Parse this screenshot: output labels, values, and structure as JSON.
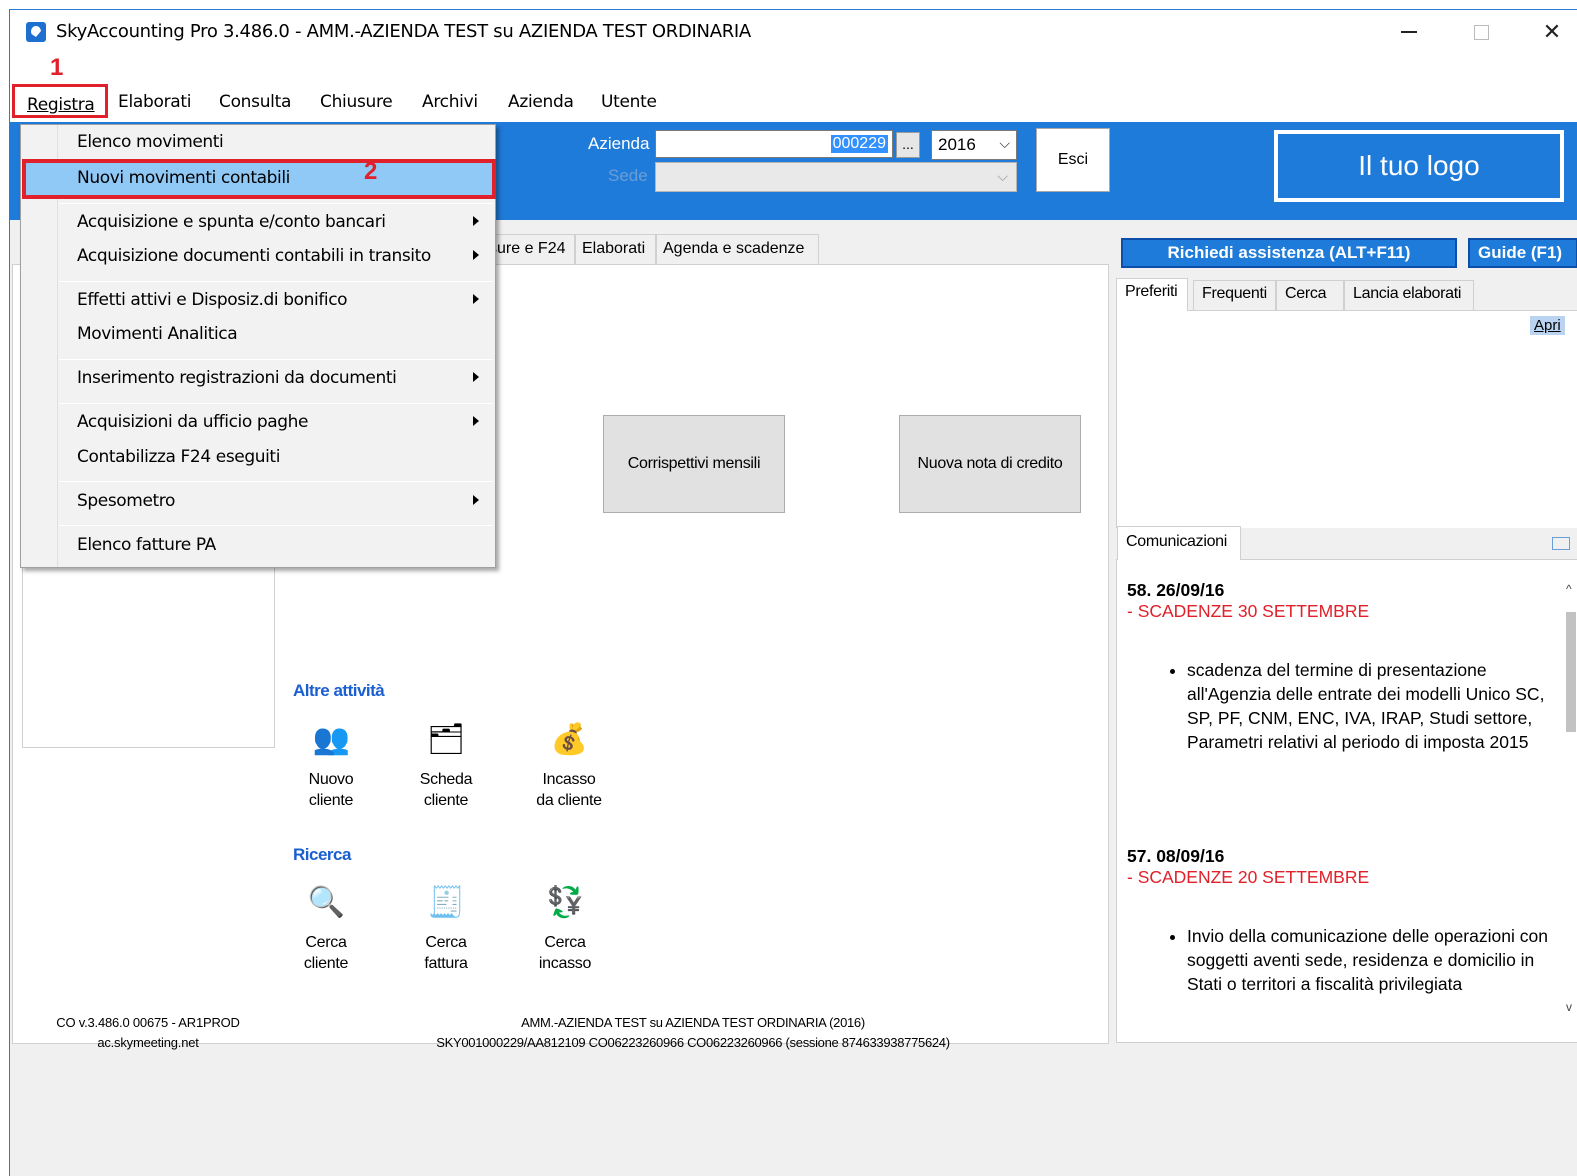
{
  "window": {
    "title": "SkyAccounting Pro 3.486.0 - AMM.-AZIENDA TEST su AZIENDA TEST ORDINARIA",
    "minimize_glyph": "",
    "close_glyph": "✕"
  },
  "annotations": {
    "step1": "1",
    "step2": "2"
  },
  "menubar": {
    "items": [
      "Registra",
      "Elaborati",
      "Consulta",
      "Chiusure",
      "Archivi",
      "Azienda",
      "Utente"
    ]
  },
  "toolbar": {
    "azienda_label": "Azienda",
    "azienda_value": "000229",
    "dots_label": "...",
    "year_value": "2016",
    "sede_label": "Sede",
    "esci_label": "Esci",
    "logo_text": "Il tuo logo"
  },
  "tabs": [
    "sure e F24",
    "Elaborati",
    "Agenda e scadenze"
  ],
  "main": {
    "corrispettivi_label": "Corrispettivi mensili",
    "nota_credito_label": "Nuova nota di credito",
    "altre_attivita_title": "Altre attività",
    "ricerca_title": "Ricerca",
    "altre_items": [
      {
        "line1": "Nuovo",
        "line2": "cliente",
        "icon": "new-client-icon"
      },
      {
        "line1": "Scheda",
        "line2": "cliente",
        "icon": "client-card-icon"
      },
      {
        "line1": "Incasso",
        "line2": "da cliente",
        "icon": "client-payment-icon"
      }
    ],
    "ricerca_items": [
      {
        "line1": "Cerca",
        "line2": "cliente",
        "icon": "search-client-icon"
      },
      {
        "line1": "Cerca",
        "line2": "fattura",
        "icon": "search-invoice-icon"
      },
      {
        "line1": "Cerca",
        "line2": "incasso",
        "icon": "search-payment-icon"
      }
    ]
  },
  "footer": {
    "version": "CO v.3.486.0 00675 - AR1PROD",
    "host": "ac.skymeeting.net",
    "company": "AMM.-AZIENDA TEST su AZIENDA TEST ORDINARIA (2016)",
    "session": "SKY001000229/AA812109 CO06223260966 CO06223260966 (sessione 874633938775624)"
  },
  "right": {
    "assist_label": "Richiedi assistenza  (ALT+F11)",
    "guide_label": "Guide (F1)",
    "tabs": [
      "Preferiti",
      "Frequenti",
      "Cerca",
      "Lancia elaborati"
    ],
    "apri_label": "Apri",
    "comm_tab": "Comunicazioni",
    "news": [
      {
        "head": "58. 26/09/16",
        "subject": "- SCADENZE 30 SETTEMBRE",
        "body": "scadenza del termine di presentazione all'Agenzia delle entrate dei modelli Unico SC, SP, PF, CNM, ENC, IVA, IRAP, Studi settore, Parametri relativi al periodo di imposta 2015"
      },
      {
        "head": "57. 08/09/16",
        "subject": "- SCADENZE 20 SETTEMBRE",
        "body": "Invio della comunicazione delle operazioni con soggetti aventi sede, residenza e domicilio in Stati o territori a fiscalità privilegiata"
      }
    ]
  },
  "dropdown": {
    "items": [
      {
        "label": "Elenco movimenti",
        "submenu": false
      },
      {
        "label": "Nuovi movimenti contabili",
        "submenu": false
      },
      {
        "label": "Acquisizione e spunta e/conto bancari",
        "submenu": true
      },
      {
        "label": "Acquisizione documenti contabili in transito",
        "submenu": true
      },
      {
        "label": "Effetti attivi e Disposiz.di bonifico",
        "submenu": true
      },
      {
        "label": "Movimenti Analitica",
        "submenu": false
      },
      {
        "label": "Inserimento registrazioni da documenti",
        "submenu": true
      },
      {
        "label": "Acquisizioni da ufficio paghe",
        "submenu": true
      },
      {
        "label": "Contabilizza F24 eseguiti",
        "submenu": false
      },
      {
        "label": "Spesometro",
        "submenu": true
      },
      {
        "label": "Elenco fatture PA",
        "submenu": false
      }
    ]
  }
}
